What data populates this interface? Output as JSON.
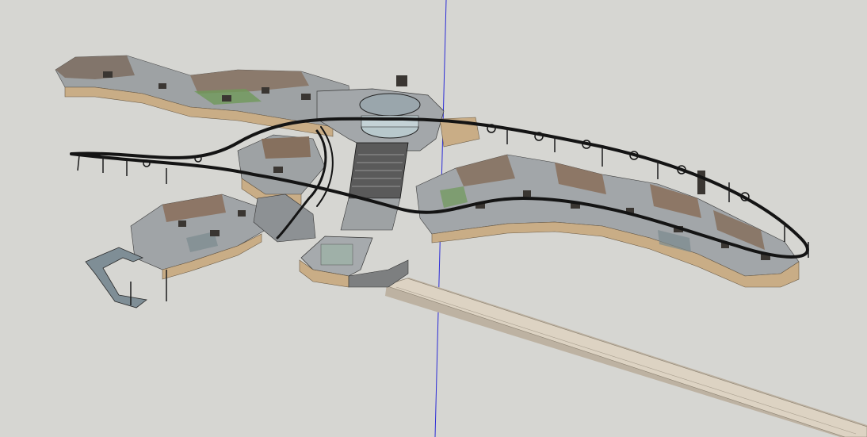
{
  "viewport": {
    "background": "#d6d6d2",
    "axis_color": "#2b2bd6"
  },
  "colors": {
    "platform_side": "#c9ad86",
    "platform_side_dark": "#a68a64",
    "platform_top": "#9a9ea3",
    "wall_tex": "#8a6f5a",
    "track": "#141414",
    "bridge_top": "#d9cfbf",
    "bridge_side": "#bdb2a2",
    "glass": "#b8c8cc",
    "ramp": "#7f8e96"
  }
}
